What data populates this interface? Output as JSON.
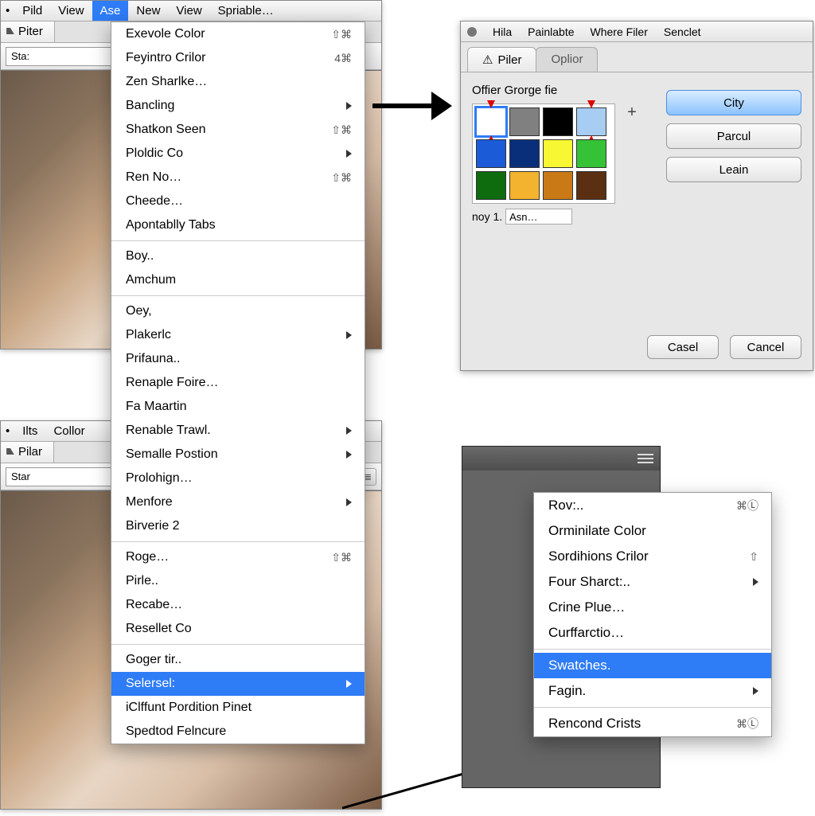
{
  "win1": {
    "menubar": [
      "Pild",
      "View",
      "Ase",
      "New",
      "View",
      "Spriable…"
    ],
    "menubar_active_index": 2,
    "tab": "Piter",
    "toolbar_select": "Sta:"
  },
  "win2": {
    "menubar": [
      "Ilts",
      "Collor"
    ],
    "tab": "Pilar",
    "toolbar_select": "Star"
  },
  "dropdown_groups": [
    [
      {
        "label": "Exevole Color",
        "shortcut": "⇧⌘"
      },
      {
        "label": "Feyintro Crilor",
        "shortcut": "4⌘"
      },
      {
        "label": "Zen Sharlke…"
      },
      {
        "label": "Bancling",
        "submenu": true
      },
      {
        "label": "Shatkon Seen",
        "shortcut": "⇧⌘"
      },
      {
        "label": "Ploldic Co",
        "submenu": true
      },
      {
        "label": "Ren No…",
        "shortcut": "⇧⌘"
      },
      {
        "label": "Cheede…"
      },
      {
        "label": "Apontablly Tabs"
      }
    ],
    [
      {
        "label": "Boy.."
      },
      {
        "label": "Amchum"
      }
    ],
    [
      {
        "label": "Oey,"
      },
      {
        "label": "Plakerlc",
        "submenu": true
      },
      {
        "label": "Prifauna.."
      },
      {
        "label": "Renaple Foire…"
      },
      {
        "label": "Fa Maartin"
      },
      {
        "label": "Renable Trawl.",
        "submenu": true
      },
      {
        "label": "Semalle Postion",
        "submenu": true
      },
      {
        "label": "Prolohign…"
      },
      {
        "label": "Menfore",
        "submenu": true
      },
      {
        "label": "Birverie 2"
      }
    ],
    [
      {
        "label": "Roge…",
        "shortcut": "⇧⌘"
      },
      {
        "label": "Pirle.."
      },
      {
        "label": "Recabe…"
      },
      {
        "label": "Resellet Co"
      }
    ],
    [
      {
        "label": "Goger tir.."
      },
      {
        "label": "Selersel:",
        "submenu": true,
        "highlight": true
      },
      {
        "label": "iClffunt Pordition Pinet"
      },
      {
        "label": "Spedtod Felncure"
      }
    ]
  ],
  "dialog": {
    "titlebar": [
      "Hila",
      "Painlabte",
      "Where Filer",
      "Senclet"
    ],
    "tabs": [
      "Piler",
      "Oplior"
    ],
    "active_tab_index": 0,
    "body_label": "Offier Grorge fie",
    "swatches": [
      {
        "c": "#ffffff",
        "selected": true,
        "arrows": true
      },
      {
        "c": "#808080"
      },
      {
        "c": "#000000"
      },
      {
        "c": "#a7cdf2",
        "arrows": true
      },
      {
        "c": "#1c5bd8"
      },
      {
        "c": "#0a2f7a"
      },
      {
        "c": "#f7f733"
      },
      {
        "c": "#36c236"
      },
      {
        "c": "#0e6b0e"
      },
      {
        "c": "#f3b32f"
      },
      {
        "c": "#c97a17"
      },
      {
        "c": "#5a2f12"
      }
    ],
    "footer_prefix": "noy 1.",
    "footer_value": "Asn…",
    "side_buttons": [
      "City",
      "Parcul",
      "Leain"
    ],
    "bottom_buttons": [
      "Casel",
      "Cancel"
    ]
  },
  "panel_popup": [
    [
      {
        "label": "Rov:..",
        "shortcut": "⌘Ⓛ"
      },
      {
        "label": "Orminilate Color"
      },
      {
        "label": "Sordihions Crilor",
        "shortcut": "⇧"
      },
      {
        "label": "Four Sharct:..",
        "submenu": true
      },
      {
        "label": "Crine Plue…"
      },
      {
        "label": "Curffarctio…"
      }
    ],
    [
      {
        "label": "Swatches.",
        "highlight": true
      },
      {
        "label": "Fagin.",
        "submenu": true
      }
    ],
    [
      {
        "label": "Rencond Crists",
        "shortcut": "⌘Ⓛ"
      }
    ]
  ]
}
